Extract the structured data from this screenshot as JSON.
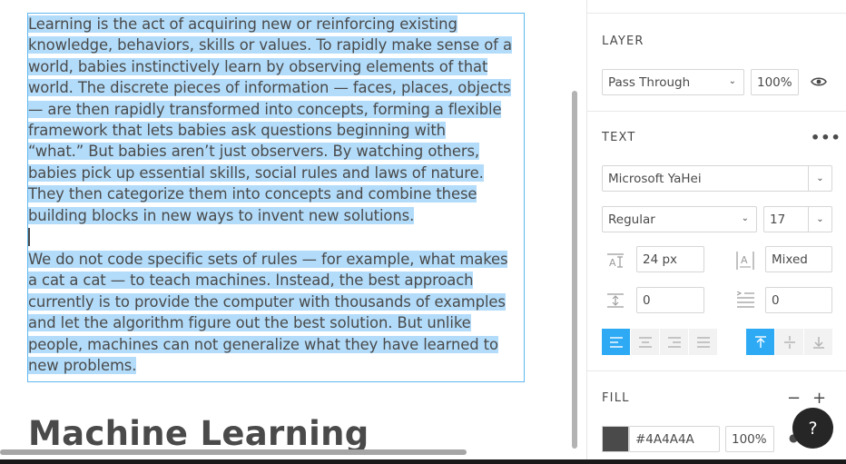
{
  "canvas": {
    "paragraph1": [
      "Learning is the act of acquiring new or reinforcing existing",
      "knowledge, behaviors, skills or values. To rapidly make sense of a",
      "world, babies instinctively learn by observing elements of that",
      "world. The discrete pieces of information — faces, places, objects",
      "— are then rapidly transformed into concepts, forming a flexible",
      "framework that lets babies ask questions beginning with",
      "“what.”  But babies aren’t just observers. By watching others,",
      "babies pick up essential skills, social rules and laws of nature.",
      "They then categorize them into concepts and combine these",
      "building blocks in new ways to invent new solutions."
    ],
    "paragraph2": [
      "We do not code specific sets of rules — for example, what makes",
      "a cat a cat — to teach machines. Instead, the best approach",
      "currently is to provide the computer with thousands of examples",
      "and let the algorithm figure out the best solution. But unlike",
      "people, machines can not generalize what they have learned to",
      "new problems."
    ],
    "heading": "Machine Learning"
  },
  "panel": {
    "layer": {
      "title": "LAYER",
      "blend_mode": "Pass Through",
      "opacity": "100%",
      "visibility_icon": "eye-icon"
    },
    "text": {
      "title": "TEXT",
      "more_icon": "more-dots-icon",
      "font_family": "Microsoft YaHei",
      "font_weight": "Regular",
      "font_size": "17",
      "line_height": "24 px",
      "letter_spacing": "Mixed",
      "paragraph_spacing": "0",
      "indent": "0",
      "horizontal_align": [
        "align-left-icon",
        "align-center-icon",
        "align-right-icon",
        "align-justify-icon"
      ],
      "vertical_align": [
        "align-top-icon",
        "align-middle-icon",
        "align-bottom-icon"
      ]
    },
    "fill": {
      "title": "FILL",
      "color": "#4A4A4A",
      "opacity": "100%"
    }
  },
  "help": {
    "label": "?"
  },
  "colors": {
    "selection": "#b3dcfa",
    "selection_border": "#5fb8f0",
    "accent": "#2eaaf5",
    "text": "#4a4a4a"
  }
}
